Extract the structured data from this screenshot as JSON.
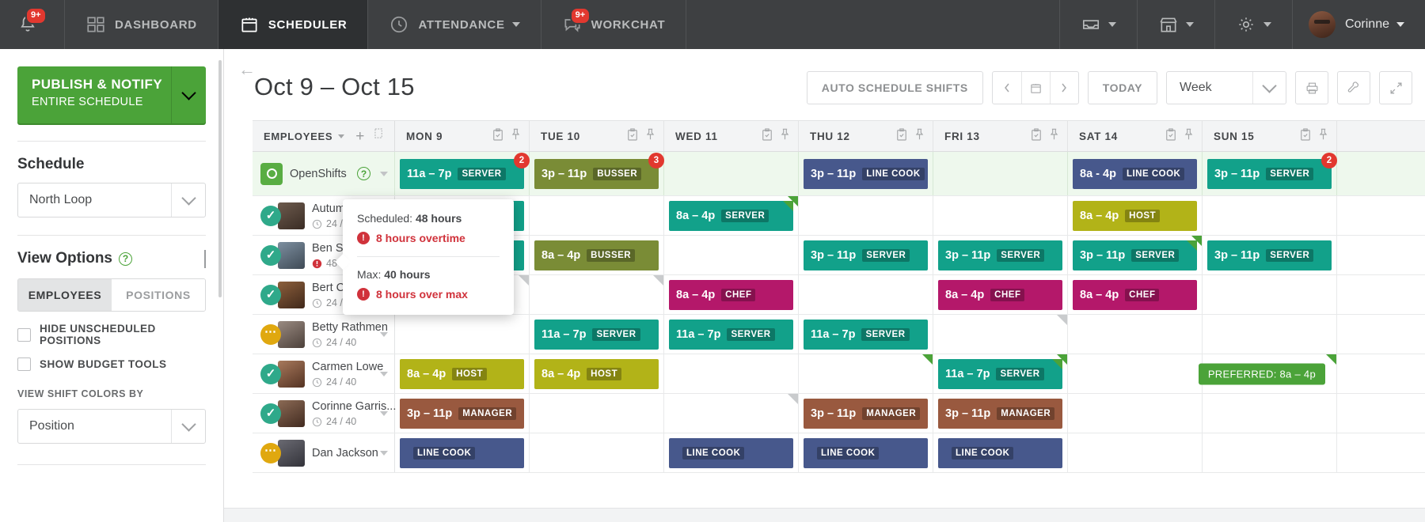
{
  "topnav": {
    "bell": {
      "icon": "bell-icon",
      "badge": "9+"
    },
    "items": [
      {
        "label": "DASHBOARD",
        "icon": "dashboard-icon",
        "active": false,
        "caret": false,
        "badge": null
      },
      {
        "label": "SCHEDULER",
        "icon": "calendar-icon",
        "active": true,
        "caret": false,
        "badge": null
      },
      {
        "label": "ATTENDANCE",
        "icon": "clock-icon",
        "active": false,
        "caret": true,
        "badge": null
      },
      {
        "label": "WORKCHAT",
        "icon": "chat-icon",
        "active": false,
        "caret": false,
        "badge": "9+"
      }
    ],
    "right_icons": [
      {
        "name": "inbox-icon",
        "caret": true
      },
      {
        "name": "store-icon",
        "caret": true
      },
      {
        "name": "gear-icon",
        "caret": true
      }
    ],
    "user": {
      "name": "Corinne",
      "avatar": "user-avatar",
      "caret": true
    }
  },
  "sidebar": {
    "publish": {
      "title": "PUBLISH & NOTIFY",
      "subtitle": "ENTIRE SCHEDULE",
      "caret_icon": "chevron-down-icon"
    },
    "schedule_heading": "Schedule",
    "schedule_select": {
      "value": "North Loop",
      "arrow_icon": "chevron-down-icon"
    },
    "view_options_heading": "View Options",
    "view_options_help": "?",
    "segments": [
      {
        "label": "EMPLOYEES",
        "selected": true
      },
      {
        "label": "POSITIONS",
        "selected": false
      }
    ],
    "checkboxes": [
      {
        "label": "HIDE UNSCHEDULED POSITIONS",
        "checked": false
      },
      {
        "label": "SHOW BUDGET TOOLS",
        "checked": false
      }
    ],
    "colors_label": "VIEW SHIFT COLORS BY",
    "colors_select": {
      "value": "Position",
      "arrow_icon": "chevron-down-icon"
    }
  },
  "toolbar": {
    "back_icon": "back-arrow-icon",
    "title": "Oct 9 – Oct 15",
    "auto_schedule_label": "AUTO SCHEDULE SHIFTS",
    "prev_icon": "chevron-left-icon",
    "calendar_icon": "calendar-icon",
    "next_icon": "chevron-right-icon",
    "today_label": "TODAY",
    "range_select": {
      "value": "Week",
      "arrow_icon": "chevron-down-icon"
    },
    "print_icon": "printer-icon",
    "tools_icon": "wrench-icon",
    "expand_icon": "expand-icon"
  },
  "grid": {
    "employees_header": {
      "label": "EMPLOYEES",
      "caret_icon": "chevron-down-icon",
      "add_icon": "plus-icon",
      "copy_icon": "copy-icon"
    },
    "days": [
      {
        "label": "MON 9",
        "clipboard_icon": "clipboard-icon",
        "pin_icon": "pin-icon"
      },
      {
        "label": "TUE 10",
        "clipboard_icon": "clipboard-icon",
        "pin_icon": "pin-icon"
      },
      {
        "label": "WED 11",
        "clipboard_icon": "clipboard-icon",
        "pin_icon": "pin-icon"
      },
      {
        "label": "THU 12",
        "clipboard_icon": "clipboard-icon",
        "pin_icon": "pin-icon"
      },
      {
        "label": "FRI 13",
        "clipboard_icon": "clipboard-icon",
        "pin_icon": "pin-icon"
      },
      {
        "label": "SAT 14",
        "clipboard_icon": "clipboard-icon",
        "pin_icon": "pin-icon"
      },
      {
        "label": "SUN 15",
        "clipboard_icon": "clipboard-icon",
        "pin_icon": "pin-icon"
      }
    ],
    "position_colors": {
      "SERVER": "#12a18a",
      "BUSSER": "#7a8c36",
      "LINE COOK": "#47588c",
      "HOST": "#b2b318",
      "CHEF": "#b4186a",
      "MANAGER": "#99593f"
    },
    "openshifts_row": {
      "label": "OpenShifts",
      "icon": "openshift-icon",
      "help": "?",
      "caret_icon": "chevron-down-icon",
      "cells": [
        {
          "time": "11a – 7p",
          "position": "SERVER",
          "count": "2"
        },
        {
          "time": "3p – 11p",
          "position": "BUSSER",
          "count": "3"
        },
        null,
        {
          "time": "3p – 11p",
          "position": "LINE COOK",
          "count": null
        },
        null,
        {
          "time": "8a - 4p",
          "position": "LINE COOK",
          "count": null
        },
        {
          "time": "3p – 11p",
          "position": "SERVER",
          "count": "2"
        }
      ]
    },
    "employees": [
      {
        "name": "Autumn Ro...",
        "hours": "24 / 40",
        "status": "ok",
        "over": false,
        "cells": [
          {
            "time": "11a – 7p",
            "position": "SERVER",
            "corner": null
          },
          null,
          {
            "time": "8a – 4p",
            "position": "SERVER",
            "corner": "green"
          },
          null,
          null,
          {
            "time": "8a – 4p",
            "position": "HOST",
            "corner": null
          },
          null
        ]
      },
      {
        "name": "Ben Shields",
        "hours": "48 / 40",
        "status": "ok",
        "over": true,
        "cells": [
          {
            "time": "11a – 7p",
            "position": "SERVER",
            "corner": null
          },
          {
            "time": "8a – 4p",
            "position": "BUSSER",
            "corner": null
          },
          null,
          {
            "time": "3p – 11p",
            "position": "SERVER",
            "corner": null
          },
          {
            "time": "3p – 11p",
            "position": "SERVER",
            "corner": null
          },
          {
            "time": "3p – 11p",
            "position": "SERVER",
            "corner": "green"
          },
          {
            "time": "3p – 11p",
            "position": "SERVER",
            "corner": null
          }
        ]
      },
      {
        "name": "Bert Castro",
        "hours": "24 / 40",
        "status": "ok",
        "over": false,
        "cells": [
          {
            "empty_corner": "gray"
          },
          {
            "empty_corner": "gray"
          },
          {
            "time": "8a – 4p",
            "position": "CHEF",
            "corner": null
          },
          null,
          {
            "time": "8a – 4p",
            "position": "CHEF",
            "corner": null
          },
          {
            "time": "8a – 4p",
            "position": "CHEF",
            "corner": null
          },
          null
        ]
      },
      {
        "name": "Betty Rathmen",
        "hours": "24 / 40",
        "status": "pending",
        "over": false,
        "cells": [
          null,
          {
            "time": "11a – 7p",
            "position": "SERVER",
            "corner": null
          },
          {
            "time": "11a – 7p",
            "position": "SERVER",
            "corner": null
          },
          {
            "time": "11a – 7p",
            "position": "SERVER",
            "corner": null
          },
          {
            "empty_corner": "gray"
          },
          null,
          null
        ]
      },
      {
        "name": "Carmen Lowe",
        "hours": "24 / 40",
        "status": "ok",
        "over": false,
        "cells": [
          {
            "time": "8a – 4p",
            "position": "HOST",
            "corner": null
          },
          {
            "time": "8a – 4p",
            "position": "HOST",
            "corner": null
          },
          null,
          {
            "empty_corner": "green"
          },
          {
            "time": "11a – 7p",
            "position": "SERVER",
            "corner": "green"
          },
          null,
          {
            "preferred": "PREFERRED: 8a – 4p",
            "corner": "green"
          }
        ]
      },
      {
        "name": "Corinne Garris...",
        "hours": "24 / 40",
        "status": "ok",
        "over": false,
        "cells": [
          {
            "time": "3p – 11p",
            "position": "MANAGER",
            "corner": null
          },
          null,
          {
            "empty_corner": "gray"
          },
          {
            "time": "3p – 11p",
            "position": "MANAGER",
            "corner": null
          },
          {
            "time": "3p – 11p",
            "position": "MANAGER",
            "corner": null
          },
          null,
          null
        ]
      },
      {
        "name": "Dan Jackson",
        "hours": "",
        "status": "pending",
        "over": false,
        "cells": [
          {
            "time": "",
            "position": "LINE COOK",
            "corner": null
          },
          null,
          {
            "time": "",
            "position": "LINE COOK",
            "corner": null
          },
          {
            "time": "",
            "position": "LINE COOK",
            "corner": null
          },
          {
            "time": "",
            "position": "LINE COOK",
            "corner": null
          },
          null,
          null
        ]
      }
    ]
  },
  "tooltip": {
    "scheduled_label": "Scheduled:",
    "scheduled_value": "48 hours",
    "overtime_text": "8 hours overtime",
    "max_label": "Max:",
    "max_value": "40 hours",
    "over_max_text": "8 hours over max",
    "alert_icon": "alert-icon"
  }
}
